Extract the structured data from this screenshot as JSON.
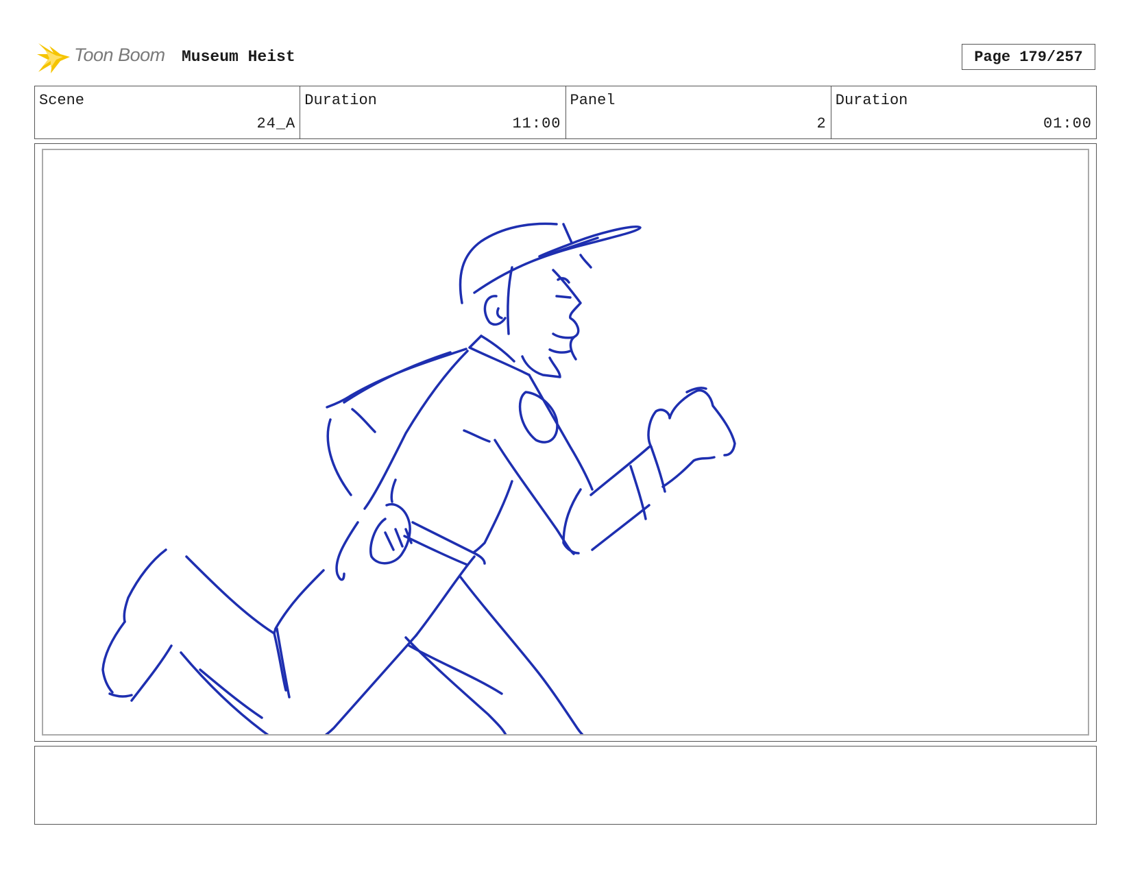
{
  "header": {
    "logo_text": "Toon Boom",
    "project_title": "Museum Heist",
    "page_label": "Page 179/257"
  },
  "info": {
    "scene_label": "Scene",
    "scene_value": "24_A",
    "scene_duration_label": "Duration",
    "scene_duration_value": "11:00",
    "panel_label": "Panel",
    "panel_value": "2",
    "panel_duration_label": "Duration",
    "panel_duration_value": "01:00"
  },
  "notes": {
    "text": ""
  },
  "colors": {
    "sketch_stroke": "#1e2fb0",
    "logo_star": "#f5c400"
  }
}
